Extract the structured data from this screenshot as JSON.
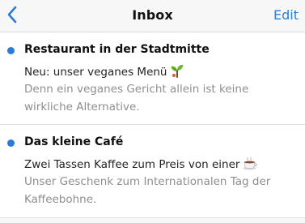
{
  "nav": {
    "title": "Inbox",
    "edit_label": "Edit",
    "back_icon": "chevron-left-icon",
    "accent_color": "#2a7cd6"
  },
  "messages": [
    {
      "sender": "Restaurant in der Stadtmitte",
      "subject": "Neu: unser veganes Menü",
      "subject_icon": "seedling-icon",
      "preview": "Denn ein veganes Gericht allein ist keine wirkliche Alternative.",
      "unread": true
    },
    {
      "sender": "Das kleine Café",
      "subject": "Zwei Tassen Kaffee zum Preis von einer",
      "subject_icon": "coffee-cup-icon",
      "preview": "Unser Geschenk zum Internationalen Tag der Kaffeebohne.",
      "unread": true
    }
  ]
}
